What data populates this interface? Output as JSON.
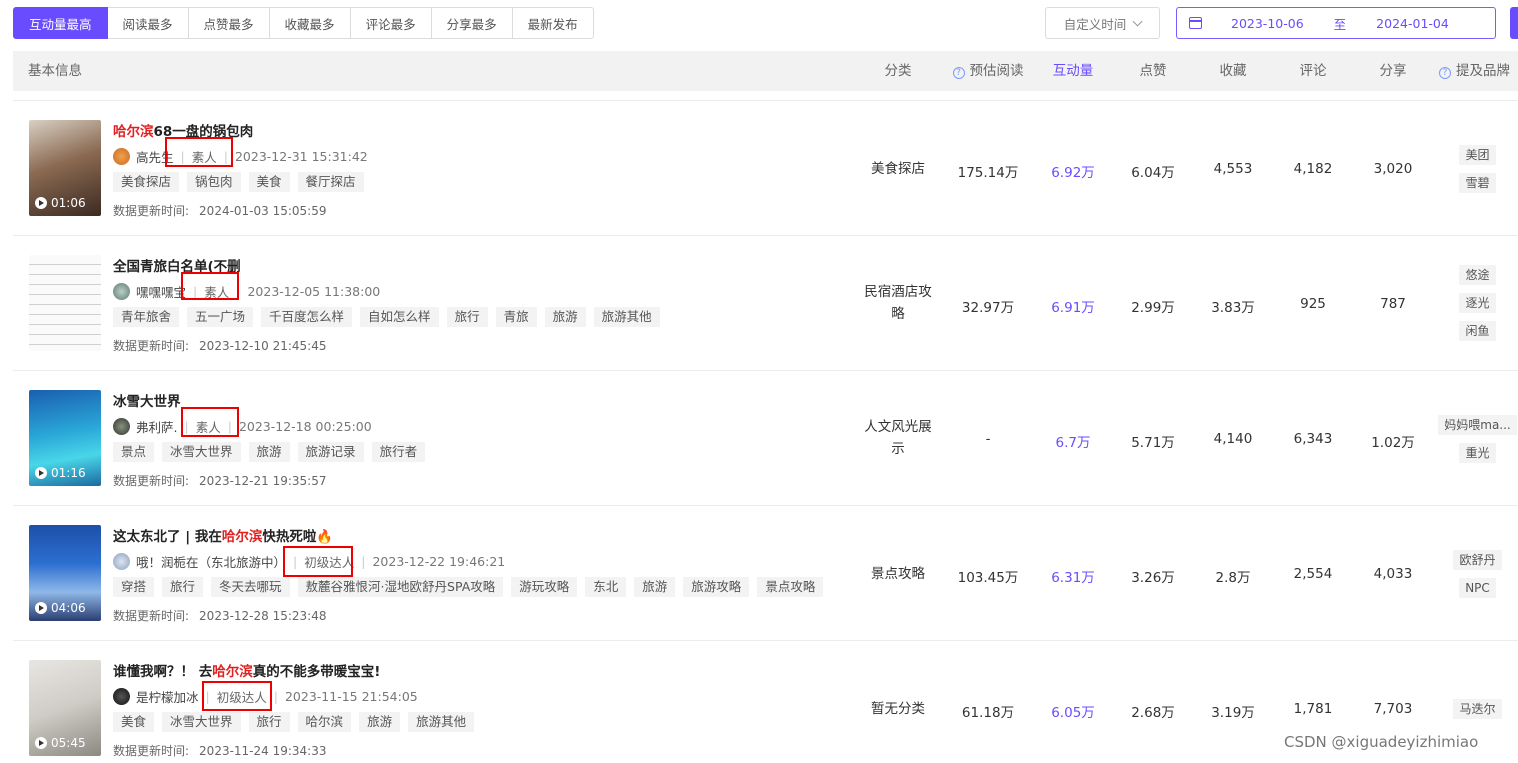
{
  "tabs": [
    "互动量最高",
    "阅读最多",
    "点赞最多",
    "收藏最多",
    "评论最多",
    "分享最多",
    "最新发布"
  ],
  "custom_time": "自定义时间",
  "date_range": {
    "start": "2023-10-06",
    "sep": "至",
    "end": "2024-01-04"
  },
  "columns": {
    "basic": "基本信息",
    "category": "分类",
    "est_read": "预估阅读",
    "interaction": "互动量",
    "likes": "点赞",
    "favorites": "收藏",
    "comments": "评论",
    "shares": "分享",
    "brands": "提及品牌"
  },
  "update_label": "数据更新时间:",
  "rows": [
    {
      "title_hl": "哈尔滨",
      "title_rest": "68一盘的锅包肉",
      "author": "高先生",
      "level": "素人",
      "publish": "2023-12-31 15:31:42",
      "duration": "01:06",
      "tags": [
        "美食探店",
        "锅包肉",
        "美食",
        "餐厅探店"
      ],
      "updated": "2024-01-03 15:05:59",
      "category": "美食探店",
      "est_read": "175.14万",
      "interaction": "6.92万",
      "likes": "6.04万",
      "favorites": "4,553",
      "comments": "4,182",
      "shares": "3,020",
      "brands": [
        "美团",
        "雪碧"
      ]
    },
    {
      "title_pre": "全国青旅白名单(不删",
      "author": "嘿嘿嘿宝",
      "level": "素人",
      "publish": "2023-12-05 11:38:00",
      "tags": [
        "青年旅舍",
        "五一广场",
        "千百度怎么样",
        "自如怎么样",
        "旅行",
        "青旅",
        "旅游",
        "旅游其他"
      ],
      "updated": "2023-12-10 21:45:45",
      "category": "民宿酒店攻略",
      "est_read": "32.97万",
      "interaction": "6.91万",
      "likes": "2.99万",
      "favorites": "3.83万",
      "comments": "925",
      "shares": "787",
      "brands": [
        "悠途",
        "逐光",
        "闲鱼"
      ]
    },
    {
      "title_pre": "冰雪大世界",
      "author": "弗利萨.",
      "level": "素人",
      "publish": "2023-12-18 00:25:00",
      "duration": "01:16",
      "tags": [
        "景点",
        "冰雪大世界",
        "旅游",
        "旅游记录",
        "旅行者"
      ],
      "updated": "2023-12-21 19:35:57",
      "category": "人文风光展示",
      "est_read": "-",
      "interaction": "6.7万",
      "likes": "5.71万",
      "favorites": "4,140",
      "comments": "6,343",
      "shares": "1.02万",
      "brands": [
        "妈妈喂ma...",
        "重光"
      ]
    },
    {
      "title_pre": "这太东北了 | 我在",
      "title_hl": "哈尔滨",
      "title_rest": "快热死啦🔥",
      "author": "哦！润栀在（东北旅游中）",
      "level": "初级达人",
      "publish": "2023-12-22 19:46:21",
      "duration": "04:06",
      "tags": [
        "穿搭",
        "旅行",
        "冬天去哪玩",
        "敖麓谷雅恨河·湿地欧舒丹SPA攻略",
        "游玩攻略",
        "东北",
        "旅游",
        "旅游攻略",
        "景点攻略"
      ],
      "updated": "2023-12-28 15:23:48",
      "category": "景点攻略",
      "est_read": "103.45万",
      "interaction": "6.31万",
      "likes": "3.26万",
      "favorites": "2.8万",
      "comments": "2,554",
      "shares": "4,033",
      "brands": [
        "欧舒丹",
        "NPC"
      ]
    },
    {
      "title_pre": "谁懂我啊？！ 去",
      "title_hl": "哈尔滨",
      "title_rest": "真的不能多带暖宝宝!",
      "author": "是柠檬加冰",
      "level": "初级达人",
      "publish": "2023-11-15 21:54:05",
      "duration": "05:45",
      "tags": [
        "美食",
        "冰雪大世界",
        "旅行",
        "哈尔滨",
        "旅游",
        "旅游其他"
      ],
      "updated": "2023-11-24 19:34:33",
      "category": "暂无分类",
      "est_read": "61.18万",
      "interaction": "6.05万",
      "likes": "2.68万",
      "favorites": "3.19万",
      "comments": "1,781",
      "shares": "7,703",
      "brands": [
        "马迭尔"
      ]
    }
  ],
  "watermark": "CSDN @xiguadeyizhimiao",
  "colors": {
    "accent": "#6a4cff",
    "highlight": "#e02020",
    "annotation": "#e00000"
  }
}
